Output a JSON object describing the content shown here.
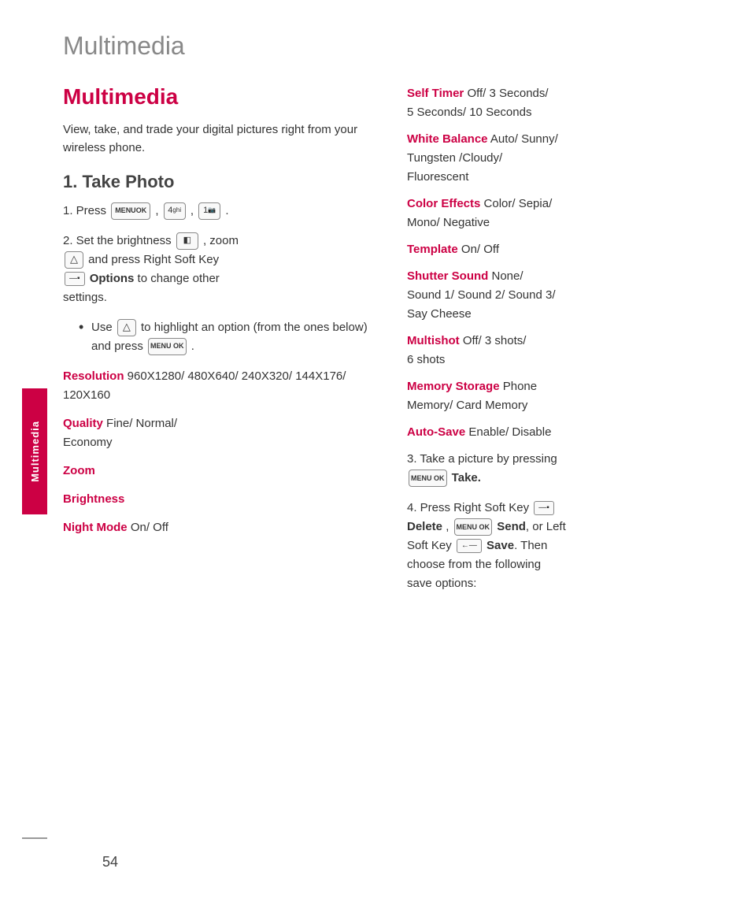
{
  "page": {
    "header_title": "Multimedia",
    "page_number": "54",
    "sidebar_label": "Multimedia"
  },
  "section_main": {
    "title": "Multimedia",
    "intro": "View, take, and trade your digital pictures right from your wireless phone."
  },
  "section_take_photo": {
    "title": "1. Take Photo",
    "step1_prefix": "1. Press",
    "step1_icons": [
      "MENU OK",
      "4 ghi",
      "1"
    ],
    "step2_prefix": "2. Set the brightness",
    "step2_mid": ", zoom",
    "step2_and_press": "and press Right Soft Key",
    "step2_options_label": "Options",
    "step2_suffix": "to change other settings.",
    "bullet1_prefix": "Use",
    "bullet1_mid": "to highlight an option (from the ones below) and press",
    "options": [
      {
        "label": "Resolution",
        "value": "960X1280/ 480X640/ 240X320/ 144X176/ 120X160"
      },
      {
        "label": "Quality",
        "value": "Fine/ Normal/ Economy"
      },
      {
        "label": "Zoom",
        "value": ""
      },
      {
        "label": "Brightness",
        "value": ""
      },
      {
        "label": "Night Mode",
        "value": "On/ Off"
      }
    ]
  },
  "right_column": {
    "options": [
      {
        "label": "Self Timer",
        "value": "Off/ 3 Seconds/ 5 Seconds/ 10 Seconds"
      },
      {
        "label": "White Balance",
        "value": "Auto/ Sunny/ Tungsten /Cloudy/ Fluorescent"
      },
      {
        "label": "Color Effects",
        "value": "Color/ Sepia/ Mono/ Negative"
      },
      {
        "label": "Template",
        "value": "On/ Off"
      },
      {
        "label": "Shutter Sound",
        "value": "None/ Sound 1/ Sound 2/ Sound 3/ Say Cheese"
      },
      {
        "label": "Multishot",
        "value": "Off/ 3 shots/ 6 shots"
      },
      {
        "label": "Memory Storage",
        "value": "Phone Memory/ Card Memory"
      },
      {
        "label": "Auto-Save",
        "value": "Enable/ Disable"
      }
    ],
    "step3_prefix": "3. Take a picture by pressing",
    "step3_icon": "MENU OK",
    "step3_bold": "Take.",
    "step4_prefix": "4. Press Right Soft Key",
    "step4_bold1": "Delete,",
    "step4_icon1": "MENU OK",
    "step4_send": "Send,",
    "step4_or": "or Left Soft Key",
    "step4_icon2": "←",
    "step4_bold2": "Save.",
    "step4_suffix": "Then choose from the following save options:"
  }
}
